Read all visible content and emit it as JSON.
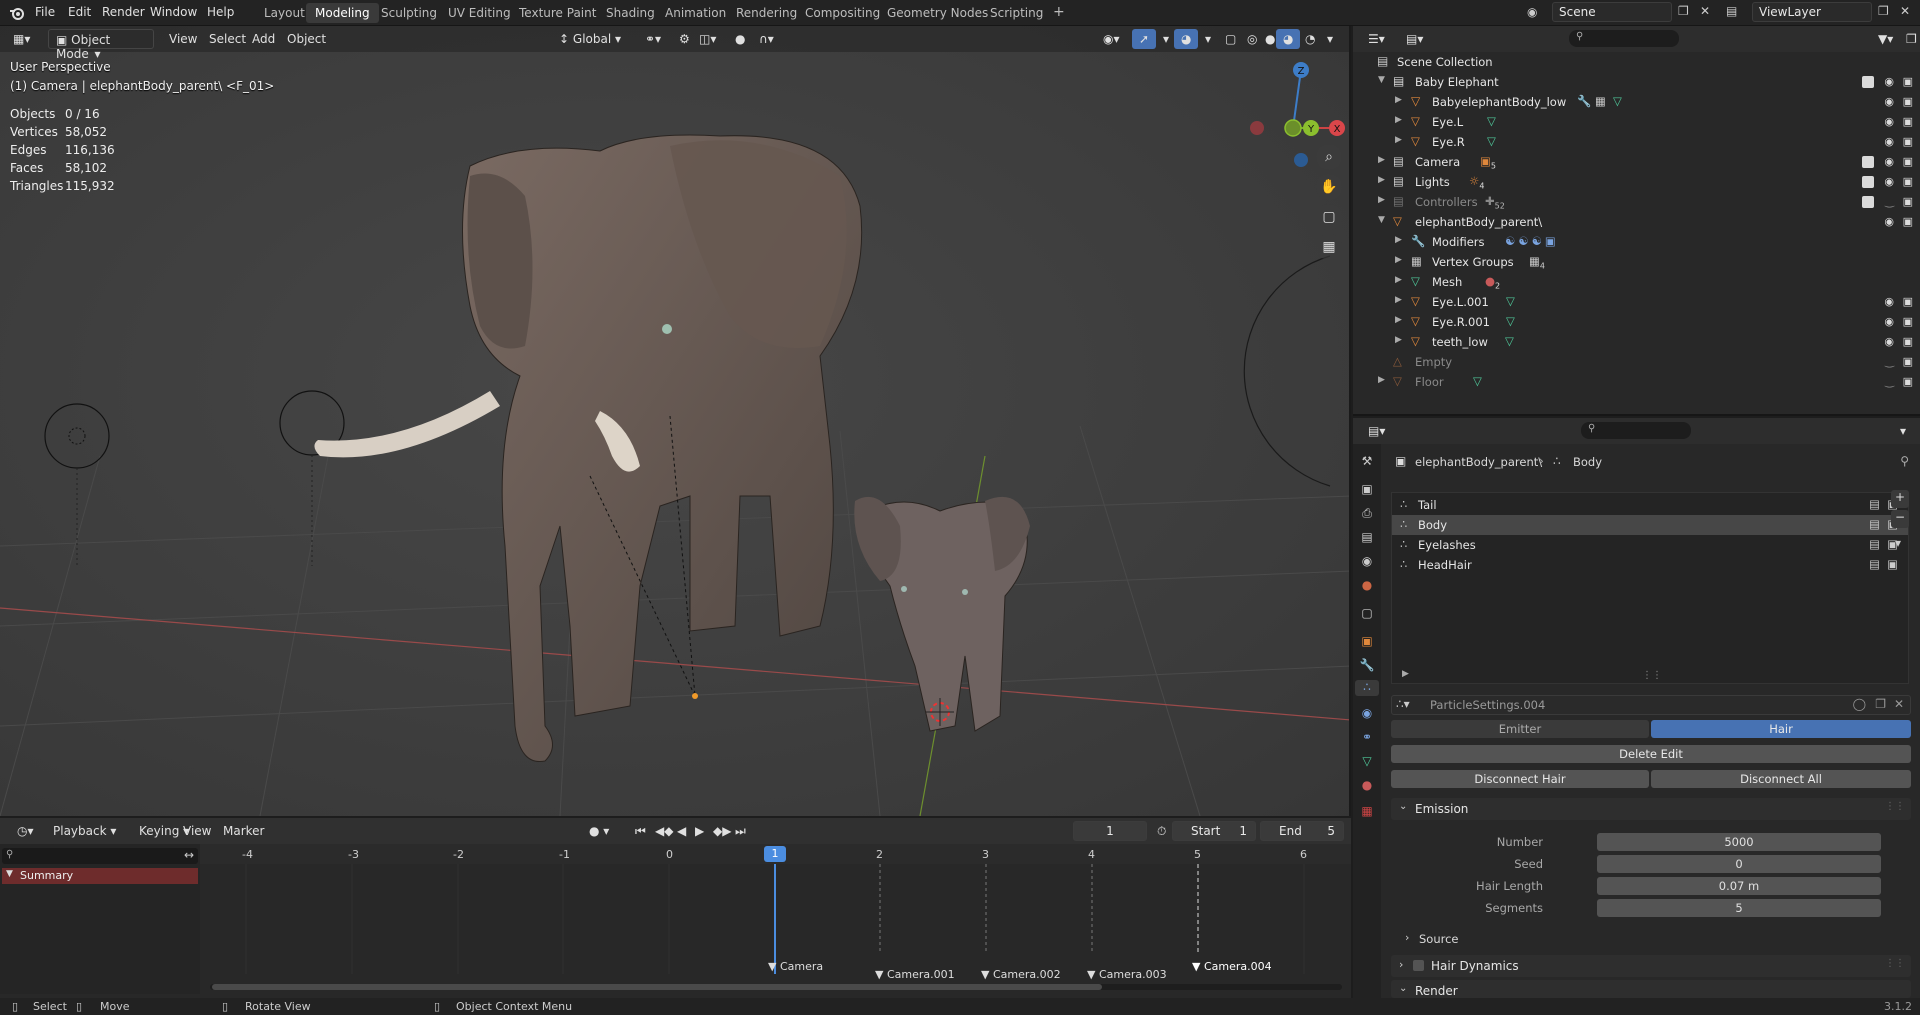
{
  "topbar": {
    "menus": [
      "File",
      "Edit",
      "Render",
      "Window",
      "Help"
    ],
    "workspaces": [
      "Layout",
      "Modeling",
      "Sculpting",
      "UV Editing",
      "Texture Paint",
      "Shading",
      "Animation",
      "Rendering",
      "Compositing",
      "Geometry Nodes",
      "Scripting"
    ],
    "active_workspace": "Modeling",
    "add_tab": "+",
    "scene": "Scene",
    "view_layer": "ViewLayer"
  },
  "viewport": {
    "mode": "Object Mode",
    "menus": [
      "View",
      "Select",
      "Add",
      "Object"
    ],
    "orientation": "Global",
    "perspective": "User Perspective",
    "active_object": "(1) Camera | elephantBody_parent\\ <F_01>",
    "stats": [
      {
        "label": "Objects",
        "value": "0 / 16"
      },
      {
        "label": "Vertices",
        "value": "58,052"
      },
      {
        "label": "Edges",
        "value": "116,136"
      },
      {
        "label": "Faces",
        "value": "58,102"
      },
      {
        "label": "Triangles",
        "value": "115,932"
      }
    ],
    "gizmo_axes": {
      "z": "Z",
      "y": "Y",
      "x": "X"
    }
  },
  "timeline": {
    "menus": [
      "Playback",
      "Keying",
      "View",
      "Marker"
    ],
    "current_frame": "1",
    "start_label": "Start",
    "start": "1",
    "end_label": "End",
    "end": "5",
    "frame_ticks": [
      "-4",
      "-3",
      "-2",
      "-1",
      "0",
      "1",
      "2",
      "3",
      "4",
      "5",
      "6"
    ],
    "summary": "Summary",
    "markers": [
      "Camera",
      "Camera.001",
      "Camera.002",
      "Camera.003",
      "Camera.004"
    ]
  },
  "statusbar": {
    "items": [
      "Select",
      "Move",
      "Rotate View",
      "Object Context Menu"
    ],
    "version": "3.1.2"
  },
  "outliner": {
    "root": "Scene Collection",
    "rows": [
      {
        "label": "Baby Elephant",
        "indent": 1,
        "type": "collection",
        "expanded": true,
        "check": true
      },
      {
        "label": "BabyelephantBody_low",
        "indent": 2,
        "type": "mesh"
      },
      {
        "label": "Eye.L",
        "indent": 2,
        "type": "mesh"
      },
      {
        "label": "Eye.R",
        "indent": 2,
        "type": "mesh"
      },
      {
        "label": "Camera",
        "indent": 1,
        "type": "collection",
        "check": true,
        "badge": "5"
      },
      {
        "label": "Lights",
        "indent": 1,
        "type": "collection",
        "check": true,
        "badge": "4"
      },
      {
        "label": "Controllers",
        "indent": 1,
        "type": "collection",
        "check": true,
        "badge": "52",
        "dim": true
      },
      {
        "label": "elephantBody_parent\\",
        "indent": 1,
        "type": "mesh",
        "expanded": true
      },
      {
        "label": "Modifiers",
        "indent": 2,
        "type": "wrench"
      },
      {
        "label": "Vertex Groups",
        "indent": 2,
        "type": "group",
        "badge": "4"
      },
      {
        "label": "Mesh",
        "indent": 2,
        "type": "meshdata",
        "badge": "2"
      },
      {
        "label": "Eye.L.001",
        "indent": 2,
        "type": "mesh"
      },
      {
        "label": "Eye.R.001",
        "indent": 2,
        "type": "mesh"
      },
      {
        "label": "teeth_low",
        "indent": 2,
        "type": "mesh"
      },
      {
        "label": "Empty",
        "indent": 1,
        "type": "empty",
        "dim": true
      },
      {
        "label": "Floor",
        "indent": 1,
        "type": "mesh",
        "dim": true
      }
    ]
  },
  "properties": {
    "breadcrumb_object": "elephantBody_parent\\",
    "breadcrumb_sep": "›",
    "breadcrumb_system": "Body",
    "particle_systems": [
      "Tail",
      "Body",
      "Eyelashes",
      "HeadHair"
    ],
    "active_system": "Body",
    "settings_name": "ParticleSettings.004",
    "type_tabs": [
      "Emitter",
      "Hair"
    ],
    "active_type": "Hair",
    "delete_edit": "Delete Edit",
    "disconnect_hair": "Disconnect Hair",
    "disconnect_all": "Disconnect All",
    "emission_title": "Emission",
    "emission_fields": [
      {
        "label": "Number",
        "value": "5000"
      },
      {
        "label": "Seed",
        "value": "0"
      },
      {
        "label": "Hair Length",
        "value": "0.07 m"
      },
      {
        "label": "Segments",
        "value": "5"
      }
    ],
    "source_title": "Source",
    "hair_dynamics_title": "Hair Dynamics",
    "render_title": "Render"
  },
  "colors": {
    "accent": "#4772b3",
    "selected_row": "#334d80",
    "mesh_icon": "#e0883c",
    "data_green": "#4fc89a",
    "timeline_marker": "#4b8de0",
    "summary_bg": "#6e2c2c"
  }
}
